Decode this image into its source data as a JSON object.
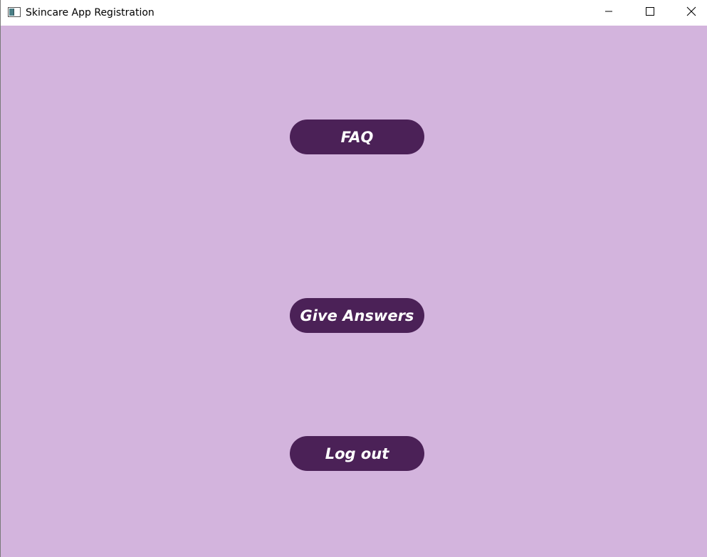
{
  "window": {
    "title": "Skincare App Registration",
    "controls": [
      "minimize-icon",
      "maximize-icon",
      "close-icon"
    ]
  },
  "menu": {
    "faq_label": "FAQ",
    "give_answers_label": "Give Answers",
    "logout_label": "Log out"
  },
  "colors": {
    "background": "#d3b4dd",
    "button": "#4b2157",
    "button_text": "#ffffff"
  }
}
